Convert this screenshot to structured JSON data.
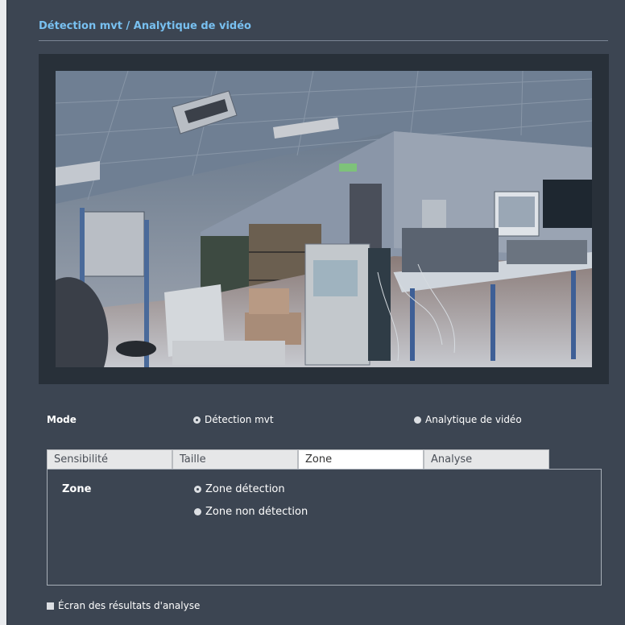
{
  "section": {
    "title": "Détection mvt / Analytique de vidéo"
  },
  "mode": {
    "label": "Mode",
    "options": [
      "Détection mvt",
      "Analytique de vidéo"
    ],
    "selected": "Détection mvt"
  },
  "tabs": {
    "items": [
      "Sensibilité",
      "Taille",
      "Zone",
      "Analyse"
    ],
    "active": "Zone"
  },
  "zone": {
    "label": "Zone",
    "options": [
      "Zone détection",
      "Zone non détection"
    ],
    "selected": "Zone détection"
  },
  "analysis_results": {
    "label": "Écran des résultats d'analyse",
    "checked": false
  },
  "colors": {
    "accent": "#78c0f0",
    "background": "#3c4552",
    "frame": "#283039"
  },
  "icons": [
    "radio-selected-icon",
    "radio-unselected-icon",
    "checkbox-icon"
  ]
}
